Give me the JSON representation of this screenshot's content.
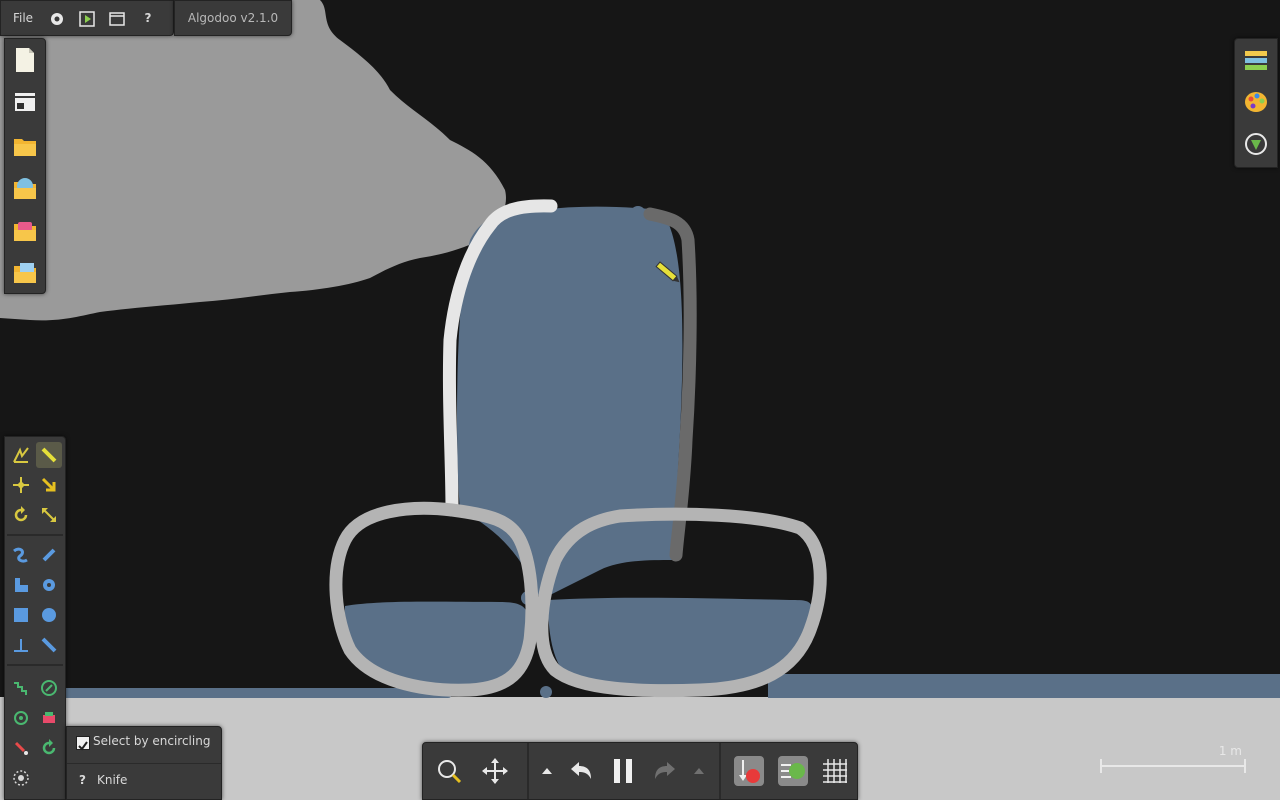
{
  "app": {
    "version_label": "Algodoo v2.1.0"
  },
  "top_menu": {
    "file_label": "File",
    "settings_icon": "gear-icon",
    "play_icon": "play-scene-icon",
    "window_icon": "window-icon",
    "help_label": "?"
  },
  "left_file_toolbar": {
    "items": [
      "new-scene-icon",
      "scene-browser-icon",
      "open-folder-icon",
      "open-scene-icon",
      "open-phunlet-icon",
      "save-scene-icon"
    ]
  },
  "right_toolbar": {
    "items": [
      "layers-icon",
      "palette-icon",
      "background-icon"
    ]
  },
  "tools_panel": {
    "rows": [
      [
        "sketch-tool",
        "knife-tool"
      ],
      [
        "move-tool",
        "drag-tool"
      ],
      [
        "rotate-tool",
        "scale-tool"
      ],
      [
        "rope-tool",
        "pen-tool"
      ],
      [
        "plane-tool",
        "gear-tool"
      ],
      [
        "box-tool",
        "circle-tool"
      ],
      [
        "fixate-tool",
        "spring-tool"
      ],
      [
        "hinge-tool",
        "laser-tool"
      ],
      [
        "thruster-tool",
        "tracer-tool"
      ],
      [
        "brush-tool",
        "chain-tool"
      ],
      [
        "water-tool",
        ""
      ]
    ],
    "active_tool": "knife-tool"
  },
  "tool_options": {
    "checkbox_label": "Select by encircling",
    "checkbox_checked": true,
    "help_label": "?",
    "tool_name": "Knife"
  },
  "bottom_toolbar": {
    "buttons": [
      "zoom-icon",
      "pan-icon",
      "undo-more-icon",
      "undo-icon",
      "pause-icon",
      "redo-icon",
      "redo-more-icon",
      "gravity-icon",
      "air-friction-icon",
      "grid-icon"
    ],
    "simulation_state": "running"
  },
  "scale_bar": {
    "label": "1 m"
  },
  "colors": {
    "background": "#161616",
    "ground": "#c8c8c8",
    "water": "#5a7088",
    "cloud": "#9a9a9a",
    "panel": "#3a3a3a",
    "highlight": "#e6e03a"
  }
}
